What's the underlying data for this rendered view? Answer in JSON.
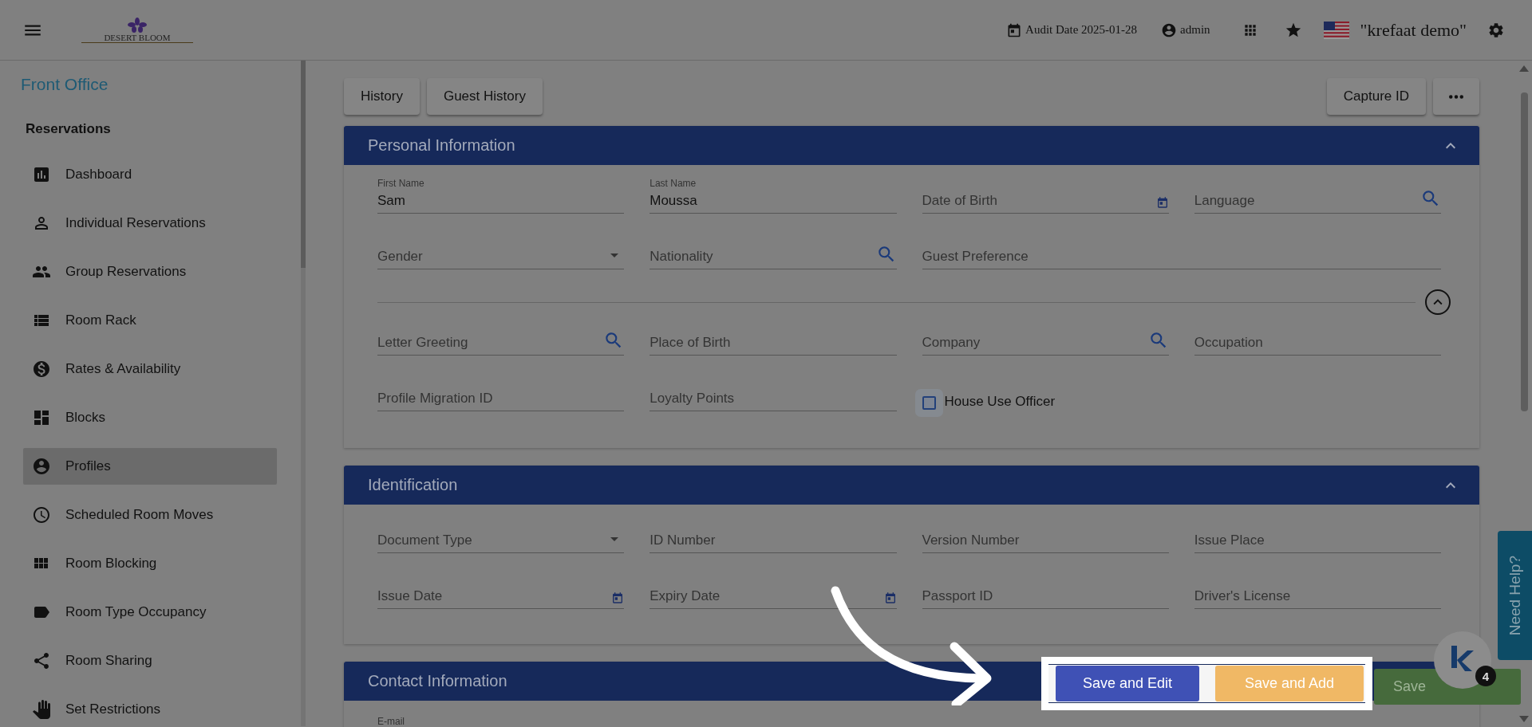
{
  "topbar": {
    "brand": "DESERT BLOOM",
    "audit_date": "Audit Date 2025-01-28",
    "user": "admin",
    "workspace": "\"krefaat demo\""
  },
  "sidebar": {
    "title": "Front Office",
    "group": "Reservations",
    "items": [
      {
        "label": "Dashboard",
        "selected": false
      },
      {
        "label": "Individual Reservations",
        "selected": false
      },
      {
        "label": "Group Reservations",
        "selected": false
      },
      {
        "label": "Room Rack",
        "selected": false
      },
      {
        "label": "Rates & Availability",
        "selected": false
      },
      {
        "label": "Blocks",
        "selected": false
      },
      {
        "label": "Profiles",
        "selected": true
      },
      {
        "label": "Scheduled Room Moves",
        "selected": false
      },
      {
        "label": "Room Blocking",
        "selected": false
      },
      {
        "label": "Room Type Occupancy",
        "selected": false
      },
      {
        "label": "Room Sharing",
        "selected": false
      },
      {
        "label": "Set Restrictions",
        "selected": false
      }
    ]
  },
  "toolbar": {
    "left_buttons": [
      "History",
      "Guest History"
    ],
    "right_buttons": [
      "Capture ID"
    ]
  },
  "sections": [
    {
      "title": "Personal Information",
      "expanded": true,
      "fields": [
        {
          "kind": "text",
          "label": "First Name",
          "value": "Sam"
        },
        {
          "kind": "text",
          "label": "Last Name",
          "value": "Moussa"
        },
        {
          "kind": "date",
          "label": "Date of Birth"
        },
        {
          "kind": "search",
          "label": "Language"
        },
        {
          "kind": "select",
          "label": "Gender"
        },
        {
          "kind": "search",
          "label": "Nationality"
        },
        {
          "kind": "wide",
          "label": "Guest Preference"
        }
      ],
      "more_expanded": true,
      "more_fields": [
        {
          "kind": "search",
          "label": "Letter Greeting"
        },
        {
          "kind": "text",
          "label": "Place of Birth"
        },
        {
          "kind": "search",
          "label": "Company"
        },
        {
          "kind": "text",
          "label": "Occupation"
        },
        {
          "kind": "text",
          "label": "Profile Migration ID"
        },
        {
          "kind": "text",
          "label": "Loyalty Points"
        },
        {
          "kind": "checkbox",
          "label": "House Use Officer",
          "checked": false
        }
      ]
    },
    {
      "title": "Identification",
      "expanded": true,
      "fields": [
        {
          "kind": "select",
          "label": "Document Type"
        },
        {
          "kind": "text",
          "label": "ID Number"
        },
        {
          "kind": "text",
          "label": "Version Number"
        },
        {
          "kind": "text",
          "label": "Issue Place"
        },
        {
          "kind": "date",
          "label": "Issue Date"
        },
        {
          "kind": "date",
          "label": "Expiry Date"
        },
        {
          "kind": "text",
          "label": "Passport ID"
        },
        {
          "kind": "text",
          "label": "Driver's License"
        }
      ]
    },
    {
      "title": "Contact Information",
      "fields": [
        {
          "kind": "clipped",
          "label": "E-mail"
        }
      ]
    }
  ],
  "actions": [
    {
      "label": "Save and Edit",
      "kind": "edit"
    },
    {
      "label": "Save and Add",
      "kind": "add"
    },
    {
      "label": "Save",
      "kind": "save"
    }
  ],
  "help_tab": "Need Help?",
  "chat": {
    "badge": "4"
  }
}
